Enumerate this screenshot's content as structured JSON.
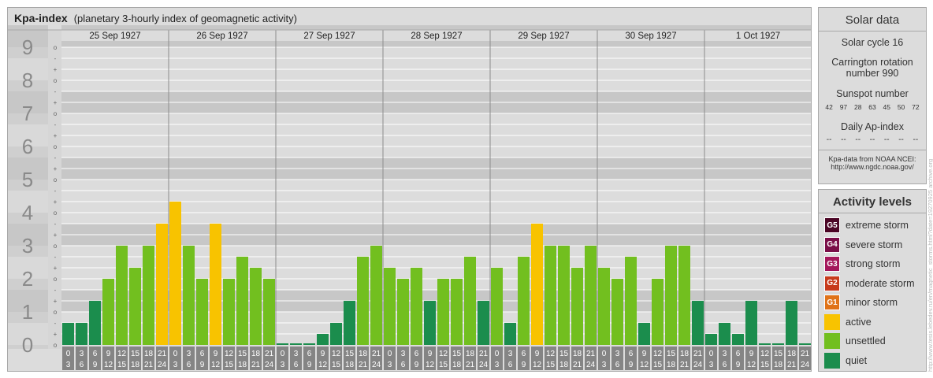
{
  "chart_data": {
    "type": "bar",
    "title": "Kpa-index",
    "subtitle": "(planetary 3-hourly index of geomagnetic activity)",
    "y_tick_labels": [
      "0",
      "1",
      "2",
      "3",
      "4",
      "5",
      "6",
      "7",
      "8",
      "9"
    ],
    "y_minor_labels": [
      "o",
      "+",
      "-"
    ],
    "ylim": [
      0,
      9.33
    ],
    "days": [
      "25 Sep 1927",
      "26 Sep 1927",
      "27 Sep 1927",
      "28 Sep 1927",
      "29 Sep 1927",
      "30 Sep 1927",
      "1 Oct 1927"
    ],
    "hour_start_labels": [
      "0",
      "3",
      "6",
      "9",
      "12",
      "15",
      "18",
      "21"
    ],
    "hour_end_labels": [
      "3",
      "6",
      "9",
      "12",
      "15",
      "18",
      "21",
      "24"
    ],
    "values": [
      [
        0.667,
        0.667,
        1.333,
        2.0,
        3.0,
        2.333,
        3.0,
        3.667
      ],
      [
        4.333,
        3.0,
        2.0,
        3.667,
        2.0,
        2.667,
        2.333,
        2.0
      ],
      [
        0.0,
        0.0,
        0.0,
        0.333,
        0.667,
        1.333,
        2.667,
        3.0
      ],
      [
        2.333,
        2.0,
        2.333,
        1.333,
        2.0,
        2.0,
        2.667,
        1.333
      ],
      [
        2.333,
        0.667,
        2.667,
        3.667,
        3.0,
        3.0,
        2.333,
        3.0
      ],
      [
        2.333,
        2.0,
        2.667,
        0.667,
        2.0,
        3.0,
        3.0,
        1.333
      ],
      [
        0.333,
        0.667,
        0.333,
        1.333,
        0.0,
        0.0,
        1.333,
        0.0
      ]
    ],
    "grid": true
  },
  "colors": {
    "quiet": "#1b8d4d",
    "unsettled": "#72bf1f",
    "active": "#f8c300",
    "g1": "#e07319",
    "g2": "#c73b1c",
    "g3": "#a4175b",
    "g4": "#7a0e48",
    "g5": "#4b0525"
  },
  "solar": {
    "title": "Solar data",
    "cycle": "Solar cycle 16",
    "carrington_1": "Carrington rotation",
    "carrington_2": "number 990",
    "sunspot_title": "Sunspot number",
    "sunspots": [
      "42",
      "97",
      "28",
      "63",
      "45",
      "50",
      "72"
    ],
    "ap_title": "Daily Ap-index",
    "ap": [
      "--",
      "--",
      "--",
      "--",
      "--",
      "--",
      "--"
    ],
    "source_1": "Kpa-data from NOAA NCEI:",
    "source_2": "http://www.ngdc.noaa.gov/"
  },
  "activity": {
    "title": "Activity levels",
    "levels": [
      {
        "badge": "G5",
        "label": "extreme storm",
        "color": "#4b0525"
      },
      {
        "badge": "G4",
        "label": "severe storm",
        "color": "#7a0e48"
      },
      {
        "badge": "G3",
        "label": "strong storm",
        "color": "#a4175b"
      },
      {
        "badge": "G2",
        "label": "moderate storm",
        "color": "#c73b1c"
      },
      {
        "badge": "G1",
        "label": "minor storm",
        "color": "#e07319"
      },
      {
        "badge": "",
        "label": "active",
        "color": "#f8c300"
      },
      {
        "badge": "",
        "label": "unsettled",
        "color": "#72bf1f"
      },
      {
        "badge": "",
        "label": "quiet",
        "color": "#1b8d4d"
      }
    ]
  },
  "watermark": "http://www.tesis.lebedev.ru/en/magnetic_storms.html?date=19270925 archive.org"
}
